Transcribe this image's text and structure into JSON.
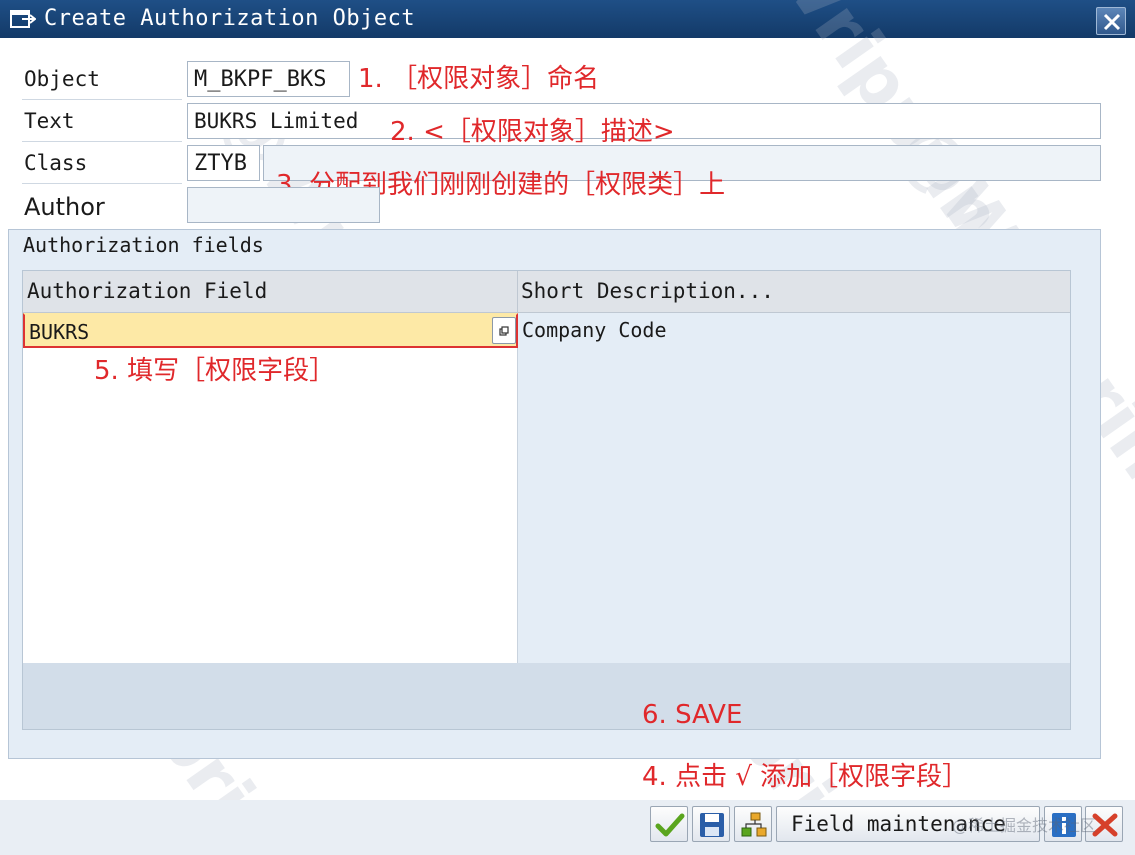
{
  "window": {
    "title": "Create Authorization Object",
    "close_icon": "close-icon"
  },
  "form": {
    "object_label": "Object",
    "object_value": "M_BKPF_BKS",
    "text_label": "Text",
    "text_value": "BUKRS Limited",
    "class_label": "Class",
    "class_value": "ZTYB",
    "class_description": "",
    "author_label": "Author",
    "author_value": ""
  },
  "annotations": {
    "a1": "1. ［权限对象］命名",
    "a2": "2. <［权限对象］描述>",
    "a3": "3. 分配到我们刚刚创建的［权限类］上",
    "a5": "5. 填写［权限字段］",
    "a6": "6. SAVE",
    "a4": "4. 点击 √ 添加［权限字段］"
  },
  "fields_group": {
    "title": "Authorization fields",
    "columns": [
      "Authorization Field",
      "Short Description..."
    ],
    "rows": [
      {
        "field": "BUKRS",
        "description": "Company Code"
      },
      {
        "field": "",
        "description": ""
      },
      {
        "field": "",
        "description": ""
      },
      {
        "field": "",
        "description": ""
      },
      {
        "field": "",
        "description": ""
      },
      {
        "field": "",
        "description": ""
      },
      {
        "field": "",
        "description": ""
      },
      {
        "field": "",
        "description": ""
      },
      {
        "field": "",
        "description": ""
      },
      {
        "field": "",
        "description": ""
      }
    ]
  },
  "toolbar": {
    "check_icon": "check-icon",
    "save_icon": "save-icon",
    "hierarchy_icon": "hierarchy-icon",
    "field_maintenance_label": "Field maintenance",
    "info_icon": "info-icon",
    "cancel_icon": "cancel-icon"
  },
  "watermark": "@Wripprin",
  "footer_watermark": "@稀土掘金技术社区",
  "colors": {
    "title_bar": "#1f4f86",
    "annotation": "#e0282b",
    "selected_cell": "#fde9a6",
    "group_bg": "#e4edf6"
  }
}
